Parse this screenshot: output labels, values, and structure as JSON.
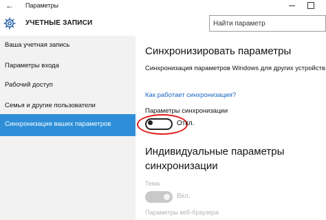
{
  "window": {
    "title": "Параметры"
  },
  "header": {
    "section_title": "УЧЕТНЫЕ ЗАПИСИ",
    "search_placeholder": "Найти параметр"
  },
  "sidebar": {
    "items": [
      {
        "label": "Ваша учетная запись",
        "active": false
      },
      {
        "label": "Параметры входа",
        "active": false
      },
      {
        "label": "Рабочий доступ",
        "active": false
      },
      {
        "label": "Семья и другие пользователи",
        "active": false
      },
      {
        "label": "Синхронизация ваших параметров",
        "active": true
      }
    ]
  },
  "main": {
    "heading": "Синхронизировать параметры",
    "description": "Синхронизация параметров Windows для других устройств, и",
    "help_link": "Как работает синхронизация?",
    "sync_label": "Параметры синхронизации",
    "sync_state": "Откл.",
    "sync_enabled": false,
    "individual_heading": "Индивидуальные параметры синхронизации",
    "theme_label": "Тема",
    "theme_state": "Вкл.",
    "theme_enabled": true,
    "theme_disabled_appearance": true,
    "browser_label": "Параметры веб-браузера"
  },
  "colors": {
    "accent": "#2e8fd8",
    "link": "#1a66c2",
    "highlight_ring": "#e01818",
    "sidebar_bg": "#f2f2f2",
    "disabled_text": "#b5b5b5"
  },
  "icons": {
    "back": "back-arrow-icon",
    "settings": "gear-icon"
  }
}
